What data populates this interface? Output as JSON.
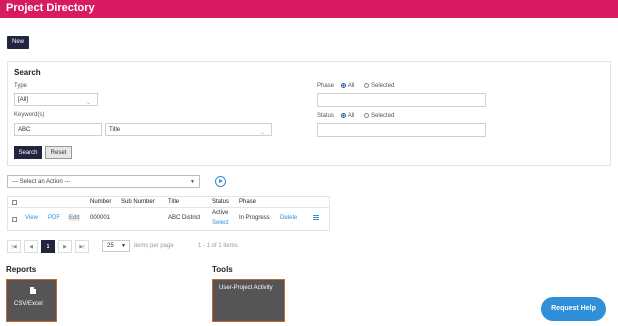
{
  "header": {
    "title": "Project Directory",
    "color": "#d81b60"
  },
  "toolbar": {
    "new_label": "New"
  },
  "search": {
    "title": "Search",
    "type_label": "Type",
    "type_value": "[All]",
    "keyword_label": "Keyword(s)",
    "keyword_value": "ABC",
    "keyword_field_value": "Title",
    "phase_label": "Phase",
    "phase_all": "All",
    "phase_selected": "Selected",
    "status_label": "Status",
    "status_all": "All",
    "status_selected": "Selected",
    "search_button": "Search",
    "reset_button": "Reset"
  },
  "actions": {
    "select_placeholder": "--- Select an Action ---"
  },
  "table": {
    "headers": [
      "Number",
      "Sub Number",
      "Title",
      "Status",
      "Phase"
    ],
    "row": {
      "view": "View",
      "pdf": "PDF",
      "edit": "Edit",
      "number": "000001",
      "sub_number": "",
      "title": "ABC District",
      "status": "Active",
      "status_action": "Select",
      "phase": "In Progress",
      "delete": "Delete"
    }
  },
  "pagination": {
    "current_page": "1",
    "page_size": "25",
    "per_page_label": "items per page",
    "summary": "1 - 1 of 1 items"
  },
  "reports": {
    "title": "Reports",
    "tile_label": "CSV/Excel"
  },
  "tools": {
    "title": "Tools",
    "tile_label": "User-Project Activity"
  },
  "help": {
    "label": "Request Help",
    "color": "#2f8fd8"
  },
  "accent": "#23243f"
}
